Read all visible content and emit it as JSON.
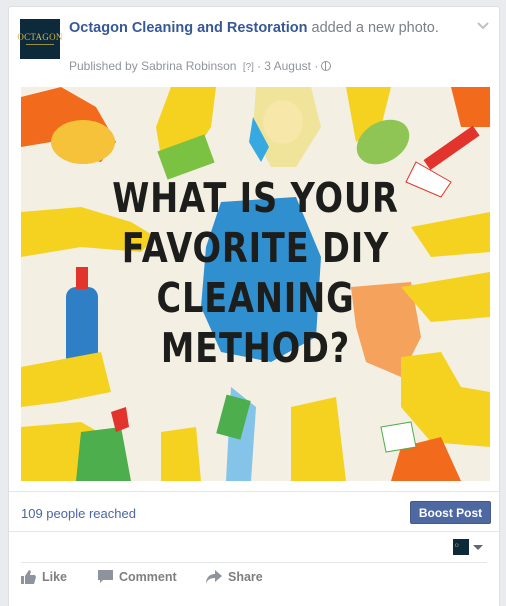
{
  "post": {
    "page_name": "Octagon Cleaning and Restoration",
    "action_text": "added a new photo.",
    "published_prefix": "Published by",
    "publisher": "Sabrina Robinson",
    "help_marker": "[?]",
    "separator": "·",
    "date": "3 August",
    "avatar_text": "OCTAGON"
  },
  "photo": {
    "text_lines": [
      "WHAT IS YOUR",
      "FAVORITE DIY",
      "CLEANING",
      "METHOD?"
    ]
  },
  "insights": {
    "reach_text": "109 people reached",
    "boost_label": "Boost Post"
  },
  "actions": {
    "like": "Like",
    "comment": "Comment",
    "share": "Share"
  },
  "colors": {
    "link": "#365899",
    "boost_bg": "#4e69a2",
    "glove_yellow": "#f4d21f"
  },
  "icons": [
    "chevron-down-icon",
    "globe-icon",
    "like-icon",
    "comment-icon",
    "share-icon",
    "caret-down-icon"
  ]
}
